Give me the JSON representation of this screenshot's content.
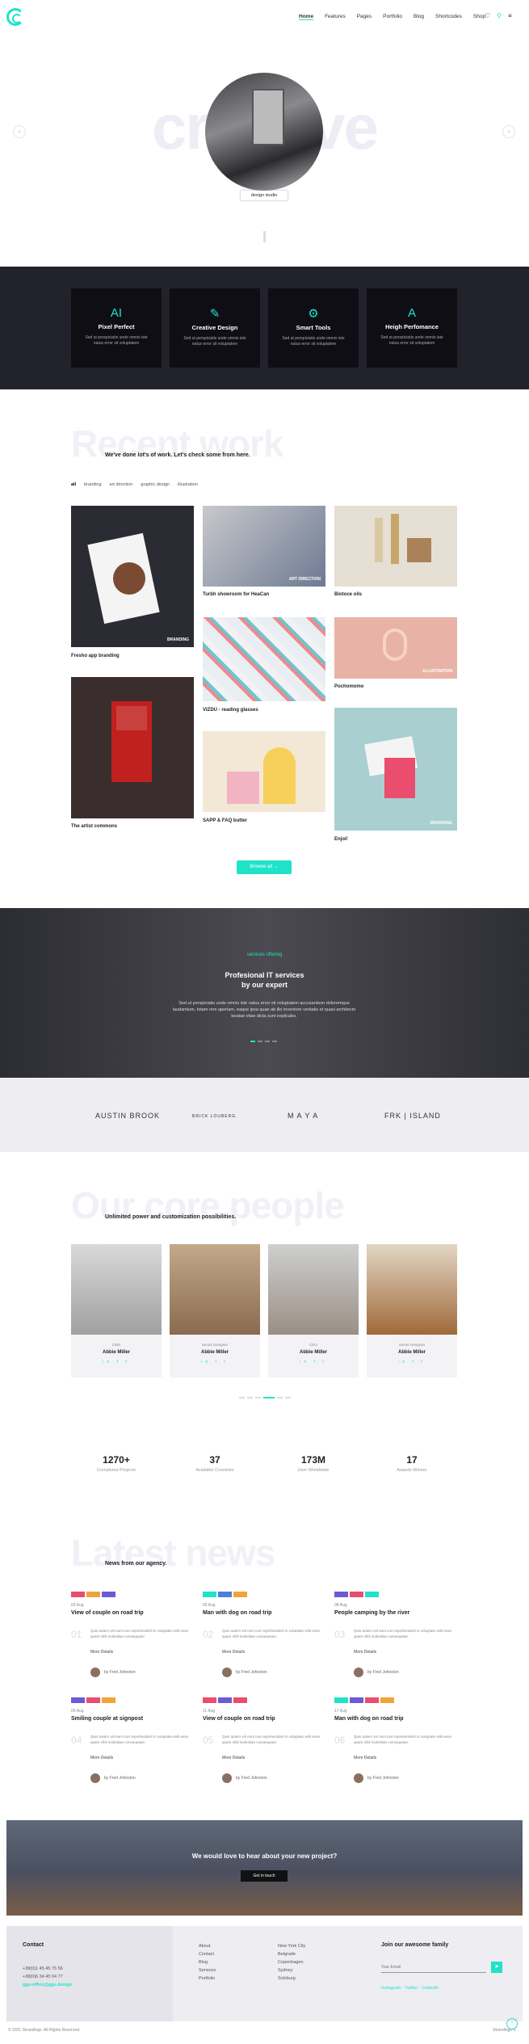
{
  "nav": {
    "items": [
      "Home",
      "Features",
      "Pages",
      "Portfolio",
      "Blog",
      "Shortcodes",
      "Shop"
    ]
  },
  "hero": {
    "word": "creative",
    "badge": "design studio"
  },
  "features": [
    {
      "icon": "AI",
      "title": "Pixel Perfect",
      "text": "Sed ut perspiciatis unde omnis iste natus error sit voluptatem"
    },
    {
      "icon": "✎",
      "title": "Creative Design",
      "text": "Sed ut perspiciatis unde omnis iste natus error sit voluptatem"
    },
    {
      "icon": "⚙",
      "title": "Smart Tools",
      "text": "Sed ut perspiciatis unde omnis iste natus error sit voluptatem"
    },
    {
      "icon": "A",
      "title": "Heigh Perfomance",
      "text": "Sed ut perspiciatis unde omnis iste natus error sit voluptatem"
    }
  ],
  "work": {
    "big": "Recent work",
    "subtitle": "We've done lot's of work. Let's check some from here.",
    "filters": [
      "all",
      "branding",
      "art direction",
      "graphic design",
      "illustration"
    ],
    "items": [
      {
        "label": "Fresho app branding",
        "tag": "BRANDING"
      },
      {
        "label": "Turbh showroom for HeaCan",
        "tag": "ART DIRECTION"
      },
      {
        "label": "Biotoce oils",
        "tag": ""
      },
      {
        "label": "VIZDU - reading glasses",
        "tag": ""
      },
      {
        "label": "Pochomomo",
        "tag": "ILLUSTRATION"
      },
      {
        "label": "The artist commons",
        "tag": ""
      },
      {
        "label": "SAPP & FAQ butter",
        "tag": ""
      },
      {
        "label": "Enjoi!",
        "tag": "BRANDING"
      }
    ],
    "button": "Browse all"
  },
  "services": {
    "label": "services offering",
    "title_1": "Profesional IT services",
    "title_2": "by our expert",
    "text": "Sed ut perspiciatis unde omnis iste natus error sit voluptatem accusantium doloremque laudantium, totam rem aperiam, eaque ipsa quae ab illo inventore veritatis et quasi architecto beatae vitae dicta sunt explicabo."
  },
  "clients": [
    "AUSTIN BROOK",
    "BRICK LOUBERG",
    "M A Y A",
    "FRK | ISLAND"
  ],
  "people": {
    "big": "Our core people",
    "subtitle": "Unlimited power and customization possibilities.",
    "members": [
      {
        "role": "CMO",
        "name": "Abbie Miller"
      },
      {
        "role": "Senior Designer",
        "name": "Abbie Miller"
      },
      {
        "role": "CEO",
        "name": "Abbie Miller"
      },
      {
        "role": "Senior Designer",
        "name": "Abbie Miller"
      }
    ]
  },
  "stats": [
    {
      "value": "1270+",
      "label": "Completed Projects"
    },
    {
      "value": "37",
      "label": "Available Countries"
    },
    {
      "value": "173M",
      "label": "User Worldwide"
    },
    {
      "value": "17",
      "label": "Awards Winner"
    }
  ],
  "news": {
    "big": "Latest news",
    "subtitle": "News from our agency.",
    "posts": [
      {
        "num": "01",
        "date": "03 Aug",
        "title": "View of couple on road trip"
      },
      {
        "num": "02",
        "date": "05 Aug",
        "title": "Man with dog on road trip"
      },
      {
        "num": "03",
        "date": "08 Aug",
        "title": "People camping by the river"
      },
      {
        "num": "04",
        "date": "09 Aug",
        "title": "Smiling couple at signpost"
      },
      {
        "num": "05",
        "date": "11 Aug",
        "title": "View of couple on road trip"
      },
      {
        "num": "06",
        "date": "17 Aug",
        "title": "Man with dog on road trip"
      }
    ],
    "excerpt": "Quis autem vel eum iure reprehenderit in voluptate velit esse quam nihil molestiae consequatur.",
    "more": "More Details",
    "author": "by Fred Johnston"
  },
  "cta": {
    "title": "We would love to hear about your new project?",
    "button": "Get in touch"
  },
  "footer": {
    "contact_title": "Contact",
    "phone_1": "+38(0)1 45 45 75 56",
    "phone_2": "+38(0)6 34 45 04 77",
    "email": "ggu-office@ggs.design",
    "links_1": [
      "About",
      "Contact",
      "Blog",
      "Services",
      "Portfolio"
    ],
    "links_2": [
      "New York City",
      "Belgrade",
      "Copenhagen",
      "Sydney",
      "Solzburg"
    ],
    "newsletter_title": "Join our awesome family",
    "newsletter_label": "Your Email",
    "social": "Instagram · Twitter · Linkedin",
    "copyright": "© 2021 Strandings. All Rights Reserved.",
    "right": "Strandings ©"
  }
}
